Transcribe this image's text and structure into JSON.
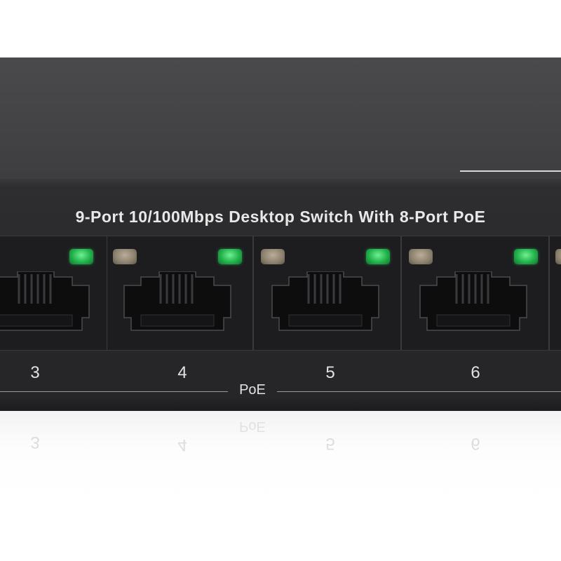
{
  "product": {
    "title": "9-Port 10/100Mbps Desktop Switch With 8-Port PoE"
  },
  "ports": [
    {
      "number": "3",
      "link_led": "off",
      "poe_led": "on"
    },
    {
      "number": "4",
      "link_led": "off",
      "poe_led": "on"
    },
    {
      "number": "5",
      "link_led": "off",
      "poe_led": "on"
    },
    {
      "number": "6",
      "link_led": "off",
      "poe_led": "on"
    }
  ],
  "poe_group": {
    "label": "PoE"
  },
  "reflection": {
    "numbers": [
      "3",
      "4",
      "5",
      "6"
    ],
    "poe_label": "PoE"
  },
  "colors": {
    "chassis_top": "#454547",
    "front_panel": "#2b2b2d",
    "port_cell": "#1d1d1f",
    "led_green": "#2fc25a",
    "led_off": "#8a806d",
    "label_text": "#e8e8e8"
  },
  "icons": {
    "port_jack": "rj45-port-icon",
    "led": "status-led-icon"
  }
}
